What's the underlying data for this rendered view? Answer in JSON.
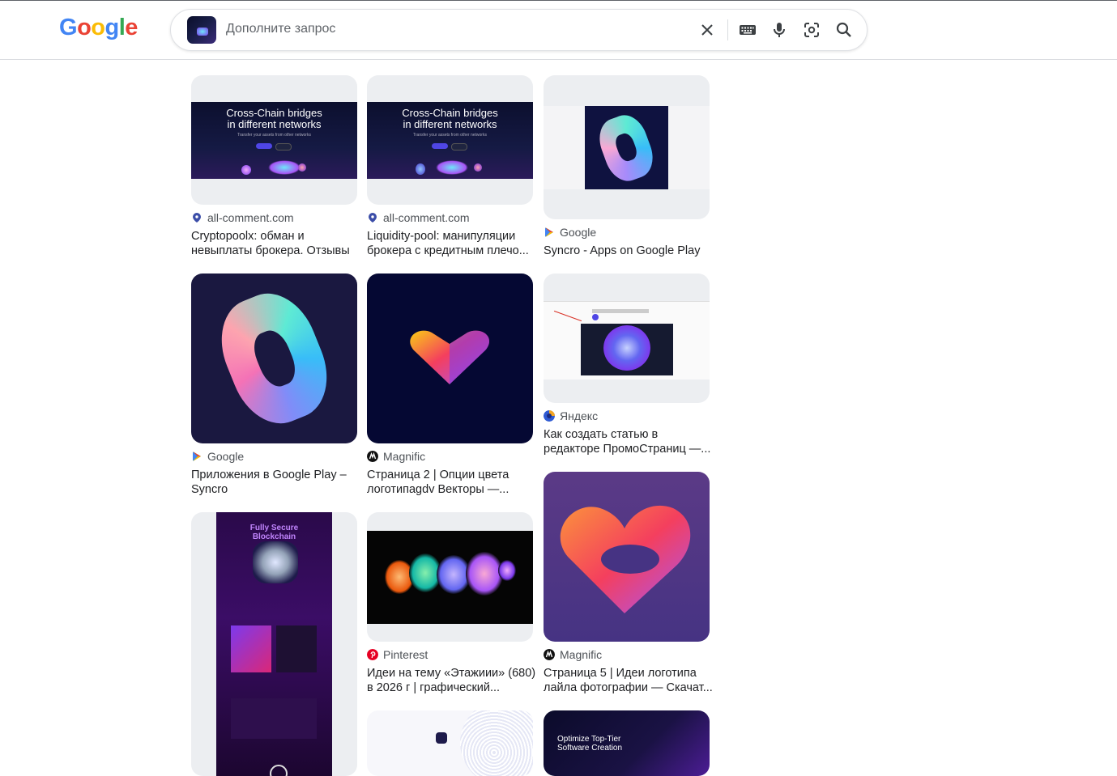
{
  "brand": {
    "logo_letters": [
      "G",
      "o",
      "o",
      "g",
      "l",
      "e"
    ],
    "logo_colors": [
      "#4285F4",
      "#EA4335",
      "#FBBC05",
      "#4285F4",
      "#34A853",
      "#EA4335"
    ]
  },
  "search": {
    "placeholder": "Дополните запрос",
    "icons": [
      "clear-icon",
      "keyboard-icon",
      "microphone-icon",
      "lens-icon",
      "search-icon"
    ]
  },
  "results": [
    {
      "source": "all-comment.com",
      "title": "Cryptopoolx: обман и невыплаты брокера. Отзывы ...",
      "favicon": "pin-icon",
      "banner_title": "Cross-Chain bridges\nin different networks",
      "banner_sub": "Transfer your assets from other networks"
    },
    {
      "source": "all-comment.com",
      "title": "Liquidity-pool: манипуляции брокера с кредитным плечо...",
      "favicon": "pin-icon",
      "banner_title": "Cross-Chain bridges\nin different networks",
      "banner_sub": "Transfer your assets from other networks"
    },
    {
      "source": "Google",
      "title": "Syncro - Apps on Google Play",
      "favicon": "google-play-icon"
    },
    {
      "source": "Google",
      "title": "Приложения в Google Play – Syncro",
      "favicon": "google-play-icon"
    },
    {
      "source": "Magnific",
      "title": "Страница 2 | Опции цвета логотипаgdv Векторы —...",
      "favicon": "magnific-icon"
    },
    {
      "source": "Яндекс",
      "title": "Как создать статью в редакторе ПромоСтраниц —...",
      "favicon": "yandex-icon"
    },
    {
      "source": "",
      "title": "",
      "favicon": "",
      "banner_title": "Fully Secure\nBlockchain"
    },
    {
      "source": "Pinterest",
      "title": "Идеи на тему «Этажиии» (680) в 2026 г | графический...",
      "favicon": "pinterest-icon"
    },
    {
      "source": "Magnific",
      "title": "Страница 5 | Идеи логотипа лайла фотографии — Скачат...",
      "favicon": "magnific-icon"
    },
    {
      "source": "",
      "title": "",
      "favicon": ""
    },
    {
      "source": "",
      "title": "",
      "favicon": "",
      "banner_title": "Optimize Top-Tier\nSoftware Creation"
    }
  ]
}
